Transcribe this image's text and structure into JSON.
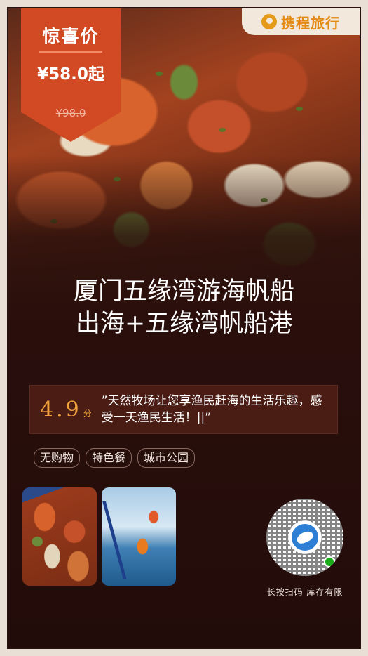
{
  "badge": {
    "title": "惊喜价",
    "price": "¥58.0起",
    "original_price": "¥98.0",
    "color": "#d24a23"
  },
  "brand": {
    "name": "携程旅行",
    "logo_icon": "ctrip-logo-icon",
    "color": "#e38a15"
  },
  "title": {
    "line1": "厦门五缘湾游海帆船",
    "line2": "出海+五缘湾帆船港"
  },
  "rating": {
    "score": "4.9",
    "unit": "分",
    "quote": "”天然牧场让您享渔民赶海的生活乐趣，感受一天渔民生活！||”",
    "accent": "#f0a23c"
  },
  "tags": [
    "无购物",
    "特色餐",
    "城市公园"
  ],
  "qr": {
    "caption": "长按扫码  库存有限",
    "center_icon": "dolphin-icon",
    "mini_icon": "wechat-miniprogram-icon"
  }
}
